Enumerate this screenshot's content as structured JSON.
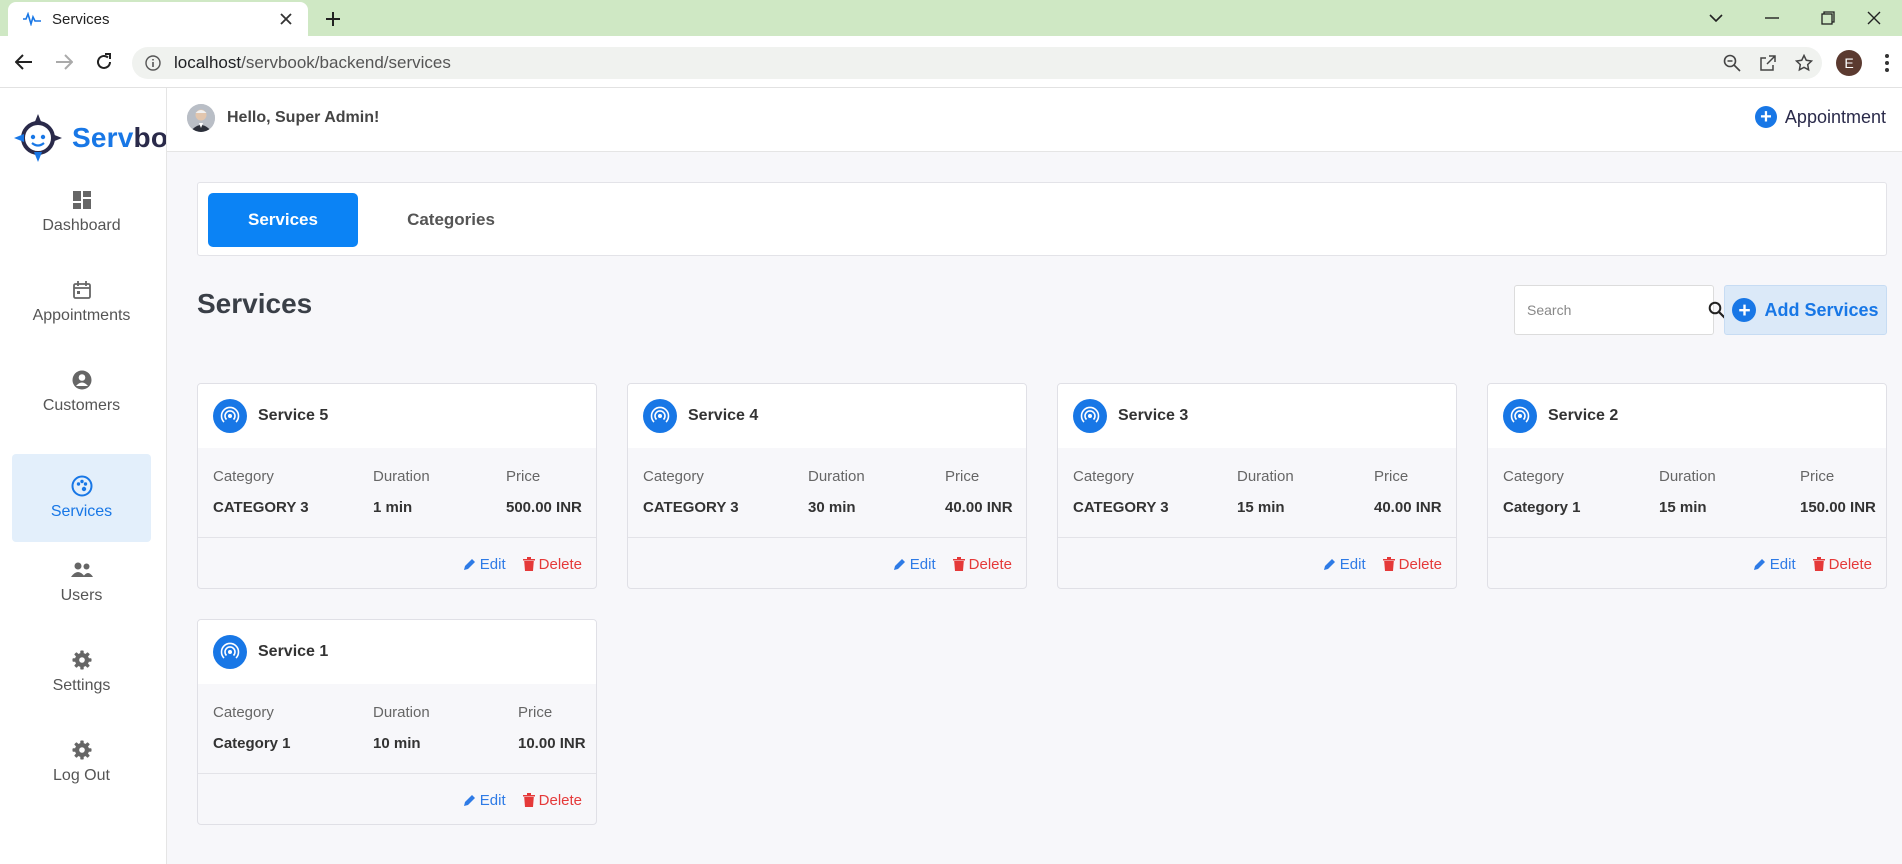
{
  "browser": {
    "tab_title": "Services",
    "url_host": "localhost",
    "url_path": "/servbook/backend/services",
    "profile_initial": "E"
  },
  "sidebar": {
    "logo_text_blue": "Serv",
    "logo_text_dark": "bo",
    "items": [
      {
        "label": "Dashboard",
        "icon": "dashboard-icon"
      },
      {
        "label": "Appointments",
        "icon": "calendar-icon"
      },
      {
        "label": "Customers",
        "icon": "user-circle-icon"
      },
      {
        "label": "Services",
        "icon": "services-icon",
        "active": true
      },
      {
        "label": "Users",
        "icon": "users-icon"
      },
      {
        "label": "Settings",
        "icon": "gear-icon"
      },
      {
        "label": "Log Out",
        "icon": "gear-icon"
      }
    ]
  },
  "topbar": {
    "greeting": "Hello, Super Admin!",
    "appointment_label": "Appointment"
  },
  "tabs": {
    "services": "Services",
    "categories": "Categories"
  },
  "page": {
    "title": "Services",
    "search_placeholder": "Search",
    "add_label": "Add Services"
  },
  "labels": {
    "category": "Category",
    "duration": "Duration",
    "price": "Price",
    "edit": "Edit",
    "delete": "Delete"
  },
  "services": [
    {
      "name": "Service 5",
      "category": "CATEGORY 3",
      "duration": "1 min",
      "price": "500.00 INR"
    },
    {
      "name": "Service 4",
      "category": "CATEGORY 3",
      "duration": "30 min",
      "price": "40.00 INR"
    },
    {
      "name": "Service 3",
      "category": "CATEGORY 3",
      "duration": "15 min",
      "price": "40.00 INR"
    },
    {
      "name": "Service 2",
      "category": "Category 1",
      "duration": "15 min",
      "price": "150.00 INR"
    },
    {
      "name": "Service 1",
      "category": "Category 1",
      "duration": "10 min",
      "price": "10.00 INR"
    }
  ],
  "colors": {
    "primary": "#1877e6",
    "tab_active": "#0b83f5",
    "delete": "#e53939",
    "chrome_tabbar": "#cfe8c4"
  }
}
